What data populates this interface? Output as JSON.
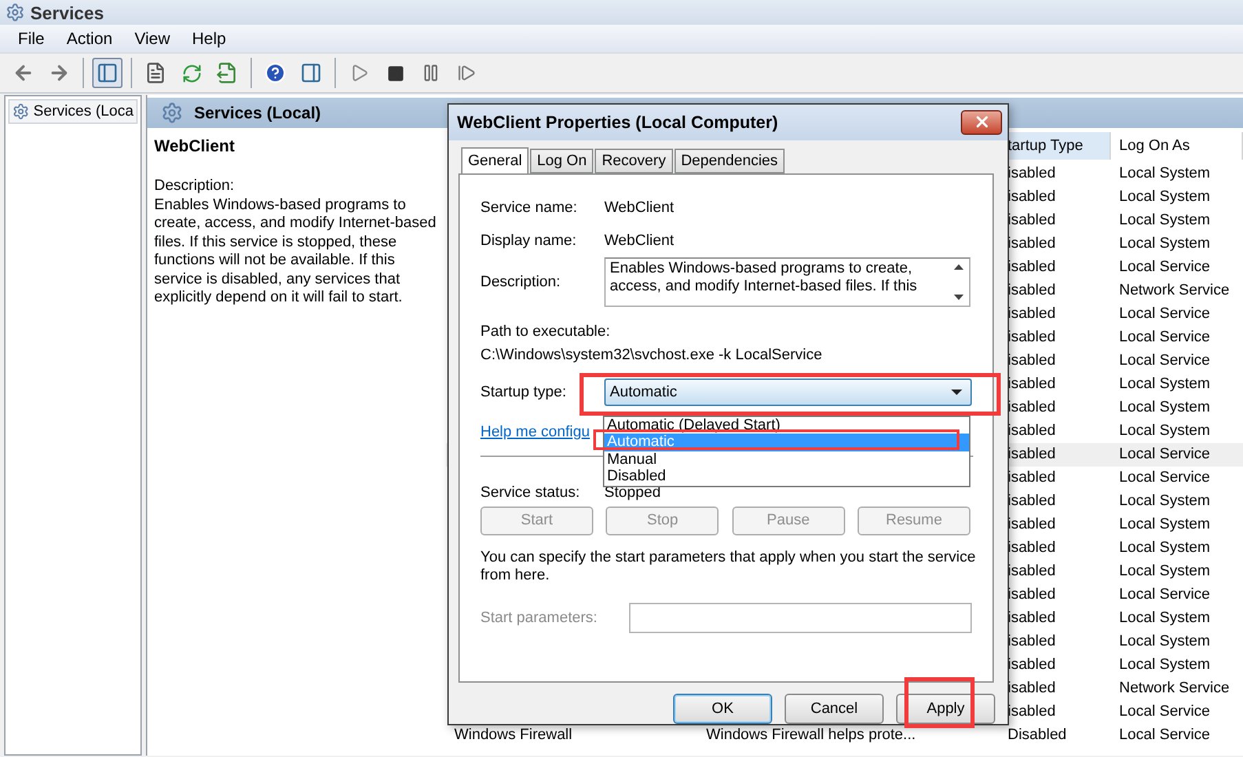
{
  "window": {
    "title": "Services"
  },
  "menu": [
    "File",
    "Action",
    "View",
    "Help"
  ],
  "toolbar": [
    {
      "kind": "back",
      "pressed": false
    },
    {
      "kind": "forward",
      "pressed": false
    },
    {
      "kind": "separator"
    },
    {
      "kind": "tree",
      "pressed": true
    },
    {
      "kind": "separator"
    },
    {
      "kind": "properties",
      "pressed": false
    },
    {
      "kind": "refresh",
      "pressed": false
    },
    {
      "kind": "export",
      "pressed": false
    },
    {
      "kind": "separator"
    },
    {
      "kind": "help",
      "pressed": false
    },
    {
      "kind": "pane",
      "pressed": false
    },
    {
      "kind": "separator"
    },
    {
      "kind": "play",
      "pressed": false
    },
    {
      "kind": "stop",
      "pressed": false
    },
    {
      "kind": "pause",
      "pressed": false
    },
    {
      "kind": "resume",
      "pressed": false
    }
  ],
  "tree": {
    "items": [
      {
        "label": "Services (Loca",
        "selected": true
      }
    ]
  },
  "panel": {
    "title": "Services (Local)",
    "service": "WebClient",
    "description_label": "Description:",
    "description": "Enables Windows-based programs to create, access, and modify Internet-based files. If this service is stopped, these functions will not be available. If this service is disabled, any services that explicitly depend on it will fail to start."
  },
  "table": {
    "columns": [
      "tartup Type",
      "Log On As"
    ],
    "rows": [
      {
        "startup_type": "isabled",
        "log_on_as": "Local System",
        "selected": false
      },
      {
        "startup_type": "isabled",
        "log_on_as": "Local System",
        "selected": false
      },
      {
        "startup_type": "isabled",
        "log_on_as": "Local System",
        "selected": false
      },
      {
        "startup_type": "isabled",
        "log_on_as": "Local System",
        "selected": false
      },
      {
        "startup_type": "isabled",
        "log_on_as": "Local Service",
        "selected": false
      },
      {
        "startup_type": "isabled",
        "log_on_as": "Network Service",
        "selected": false
      },
      {
        "startup_type": "isabled",
        "log_on_as": "Local Service",
        "selected": false
      },
      {
        "startup_type": "isabled",
        "log_on_as": "Local Service",
        "selected": false
      },
      {
        "startup_type": "isabled",
        "log_on_as": "Local Service",
        "selected": false
      },
      {
        "startup_type": "isabled",
        "log_on_as": "Local System",
        "selected": false
      },
      {
        "startup_type": "isabled",
        "log_on_as": "Local System",
        "selected": false
      },
      {
        "startup_type": "isabled",
        "log_on_as": "Local System",
        "selected": false
      },
      {
        "startup_type": "isabled",
        "log_on_as": "Local Service",
        "selected": true
      },
      {
        "startup_type": "isabled",
        "log_on_as": "Local Service",
        "selected": false
      },
      {
        "startup_type": "isabled",
        "log_on_as": "Local System",
        "selected": false
      },
      {
        "startup_type": "isabled",
        "log_on_as": "Local System",
        "selected": false
      },
      {
        "startup_type": "isabled",
        "log_on_as": "Local System",
        "selected": false
      },
      {
        "startup_type": "isabled",
        "log_on_as": "Local System",
        "selected": false
      },
      {
        "startup_type": "isabled",
        "log_on_as": "Local Service",
        "selected": false
      },
      {
        "startup_type": "isabled",
        "log_on_as": "Local System",
        "selected": false
      },
      {
        "startup_type": "isabled",
        "log_on_as": "Local System",
        "selected": false
      },
      {
        "startup_type": "isabled",
        "log_on_as": "Local System",
        "selected": false
      },
      {
        "startup_type": "isabled",
        "log_on_as": "Network Service",
        "selected": false
      },
      {
        "startup_type": "isabled",
        "log_on_as": "Local Service",
        "selected": false
      },
      {
        "name": "Windows Firewall",
        "description": "Windows Firewall helps prote...",
        "startup_type": "Disabled",
        "log_on_as": "Local Service",
        "selected": false
      }
    ]
  },
  "dialog": {
    "title": "WebClient Properties (Local Computer)",
    "tabs": [
      {
        "label": "General",
        "selected": true
      },
      {
        "label": "Log On",
        "selected": false
      },
      {
        "label": "Recovery",
        "selected": false
      },
      {
        "label": "Dependencies",
        "selected": false
      }
    ],
    "service_name_label": "Service name:",
    "service_name": "WebClient",
    "display_name_label": "Display name:",
    "display_name": "WebClient",
    "description_label": "Description:",
    "description": "Enables Windows-based programs to create, access, and modify Internet-based files. If this",
    "path_label": "Path to executable:",
    "path": "C:\\Windows\\system32\\svchost.exe -k LocalService",
    "startup_label": "Startup type:",
    "startup_value": "Automatic",
    "expanded": true,
    "options": [
      {
        "label": "Automatic (Delayed Start)",
        "selected": false
      },
      {
        "label": "Automatic",
        "selected": true
      },
      {
        "label": "Manual",
        "selected": false
      },
      {
        "label": "Disabled",
        "selected": false
      }
    ],
    "help_link": "Help me configu",
    "status_label": "Service status:",
    "status": "Stopped",
    "service_buttons": [
      {
        "label": "Start",
        "disabled": true
      },
      {
        "label": "Stop",
        "disabled": true
      },
      {
        "label": "Pause",
        "disabled": true
      },
      {
        "label": "Resume",
        "disabled": true
      }
    ],
    "note": "You can specify the start parameters that apply when you start the service from here.",
    "params_label": "Start parameters:",
    "params_disabled": true,
    "buttons": [
      {
        "label": "OK",
        "default": true
      },
      {
        "label": "Cancel",
        "default": false
      },
      {
        "label": "Apply",
        "default": false
      }
    ]
  }
}
